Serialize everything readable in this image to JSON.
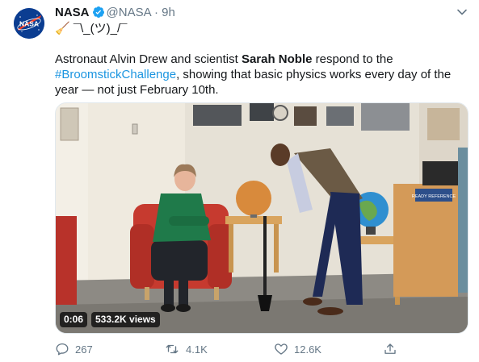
{
  "tweet": {
    "author_name": "NASA",
    "handle": "@NASA",
    "separator": "·",
    "time": "9h",
    "emoji_line": "🧹 ¯\\_(ツ)_/¯",
    "text_part1": "Astronaut Alvin Drew and scientist ",
    "text_bold": "Sarah Noble",
    "text_part2": " respond to the ",
    "hashtag": "#BroomstickChallenge",
    "text_part3": ", showing that basic physics works every day of the year — not just February 10th.",
    "avatar_text": "NASA"
  },
  "video": {
    "duration": "0:06",
    "views": "533.2K views",
    "sign_text": "READY REFERENCE"
  },
  "actions": {
    "replies": "267",
    "retweets": "4.1K",
    "likes": "12.6K"
  },
  "icons": {
    "verified": "verified-badge-icon",
    "menu": "chevron-down-icon",
    "reply": "reply-icon",
    "retweet": "retweet-icon",
    "like": "heart-icon",
    "share": "share-icon"
  },
  "colors": {
    "link": "#1b95e0",
    "secondary_text": "#657786",
    "nasa_blue": "#0b3d91",
    "nasa_red": "#fc3d21"
  }
}
